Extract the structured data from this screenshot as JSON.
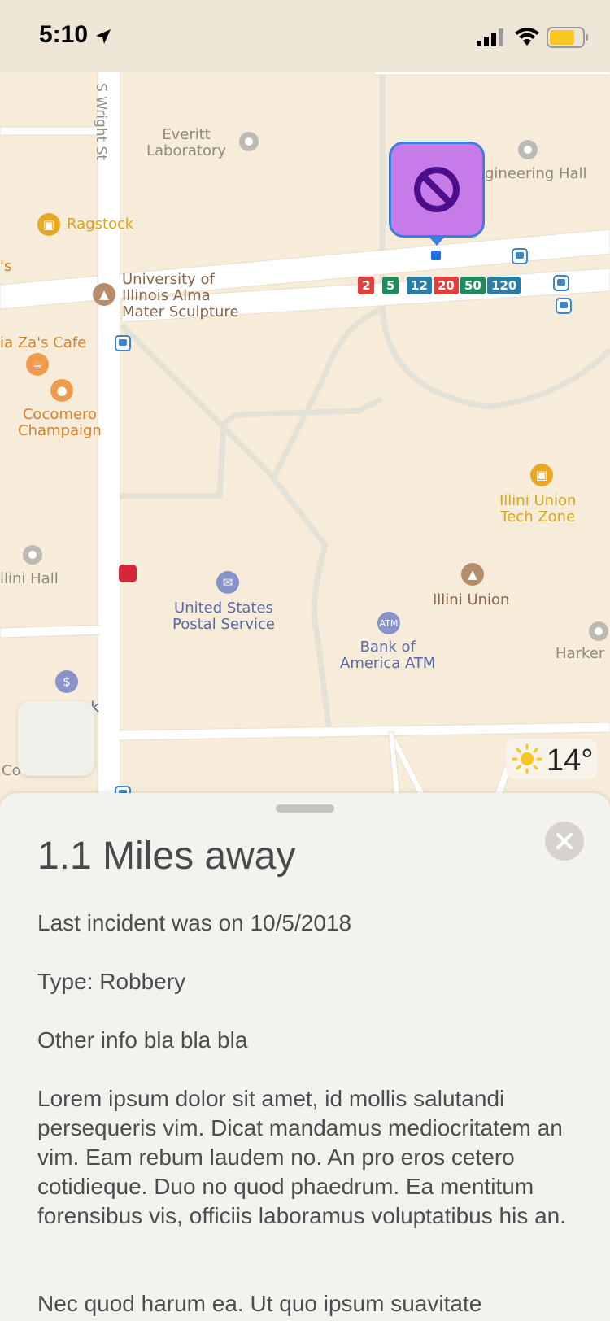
{
  "status_bar": {
    "time": "5:10"
  },
  "map": {
    "streets": {
      "wright": "S Wright St"
    },
    "places": {
      "everitt": "Everitt\nLaboratory",
      "engineering": "gineering Hall",
      "ragstock": "Ragstock",
      "s_fragment": "'s",
      "alma_mater": "University of\nIllinois Alma\nMater Sculpture",
      "za_cafe": "ia Za's Cafe",
      "cocomero": "Cocomero\nChampaign",
      "tech_zone": "Illini Union\nTech Zone",
      "illini_hall": "llini Hall",
      "usps": "United States\nPostal Service",
      "illini_union": "Illini Union",
      "bank_atm": "Bank of\nAmerica ATM",
      "harker": "Harker",
      "bank_frag": "nk",
      "co_frag": "Co"
    },
    "bus_routes": [
      {
        "label": "2",
        "color": "#e0413e"
      },
      {
        "label": "5",
        "color": "#1f8a5c"
      },
      {
        "label": "12",
        "color": "#2a7ea6"
      },
      {
        "label": "20",
        "color": "#e0413e"
      },
      {
        "label": "50",
        "color": "#1f8a5c"
      },
      {
        "label": "120",
        "color": "#2a7ea6"
      }
    ],
    "atm_badge": "ATM",
    "marker_icon": "prohibited-icon",
    "weather": {
      "temp": "14°",
      "icon": "sun-icon"
    }
  },
  "sheet": {
    "title": "1.1 Miles away",
    "last_incident": "Last incident was on 10/5/2018",
    "type": "Type: Robbery",
    "other": "Other info bla bla bla",
    "lorem1": "Lorem ipsum dolor sit amet, id mollis salutandi persequeris vim. Dicat mandamus mediocritatem an vim. Eam rebum laudem no. An pro eros cetero cotidieque. Duo no quod phaedrum. Ea mentitum forensibus vis, officiis laboramus voluptatibus his an.",
    "lorem2": "Nec quod harum ea. Ut quo ipsum suavitate"
  },
  "colors": {
    "marker": "#c77be8",
    "marker_border": "#3a7fdd",
    "pin": "#1b72e0"
  }
}
